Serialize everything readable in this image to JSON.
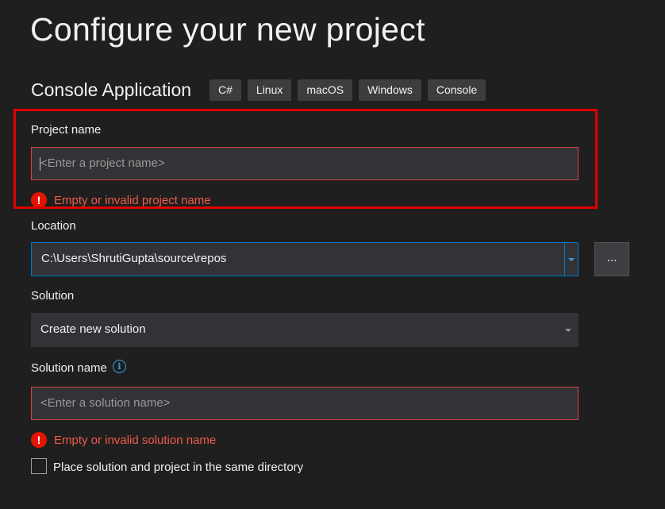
{
  "header": {
    "title": "Configure your new project",
    "template_name": "Console Application",
    "tags": [
      "C#",
      "Linux",
      "macOS",
      "Windows",
      "Console"
    ]
  },
  "project_name": {
    "label": "Project name",
    "value": "",
    "placeholder": "<Enter a project name>",
    "error": "Empty or invalid project name"
  },
  "location": {
    "label": "Location",
    "value": "C:\\Users\\ShrutiGupta\\source\\repos",
    "browse_label": "..."
  },
  "solution": {
    "label": "Solution",
    "selected": "Create new solution"
  },
  "solution_name": {
    "label": "Solution name",
    "value": "",
    "placeholder": "<Enter a solution name>",
    "error": "Empty or invalid solution name",
    "info_icon": "info-icon"
  },
  "same_directory": {
    "label": "Place solution and project in the same directory",
    "checked": false
  },
  "colors": {
    "background": "#1f1f1f",
    "error": "#f05a4a",
    "error_border": "#d74242",
    "accent": "#007acc",
    "highlight": "#e00000"
  }
}
